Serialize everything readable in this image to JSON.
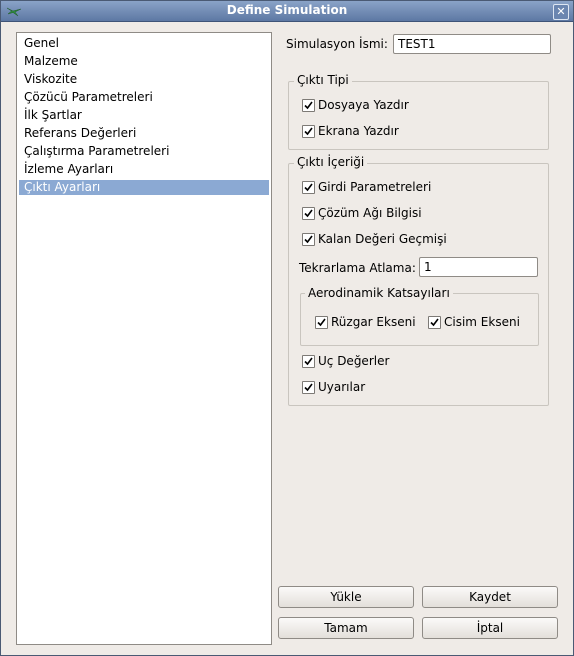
{
  "window": {
    "title": "Define Simulation"
  },
  "sidebar": {
    "items": [
      {
        "label": "Genel"
      },
      {
        "label": "Malzeme"
      },
      {
        "label": "Viskozite"
      },
      {
        "label": "Çözücü Parametreleri"
      },
      {
        "label": "İlk Şartlar"
      },
      {
        "label": "Referans Değerleri"
      },
      {
        "label": "Çalıştırma Parametreleri"
      },
      {
        "label": "İzleme Ayarları"
      },
      {
        "label": "Çıktı Ayarları",
        "selected": true
      }
    ]
  },
  "form": {
    "sim_name_label": "Simulasyon İsmi:",
    "sim_name_value": "TEST1",
    "output_type": {
      "title": "Çıktı Tipi",
      "write_file": {
        "label": "Dosyaya Yazdır",
        "checked": true
      },
      "write_screen": {
        "label": "Ekrana Yazdır",
        "checked": true
      }
    },
    "output_content": {
      "title": "Çıktı İçeriği",
      "input_params": {
        "label": "Girdi Parametreleri",
        "checked": true
      },
      "mesh_info": {
        "label": "Çözüm Ağı Bilgisi",
        "checked": true
      },
      "residual_history": {
        "label": "Kalan Değeri Geçmişi",
        "checked": true
      },
      "iter_skip_label": "Tekrarlama Atlama:",
      "iter_skip_value": "1",
      "aero": {
        "title": "Aerodinamik Katsayıları",
        "wind_axis": {
          "label": "Rüzgar Ekseni",
          "checked": true
        },
        "body_axis": {
          "label": "Cisim Ekseni",
          "checked": true
        }
      },
      "extreme_values": {
        "label": "Uç Değerler",
        "checked": true
      },
      "warnings": {
        "label": "Uyarılar",
        "checked": true
      }
    }
  },
  "buttons": {
    "load": "Yükle",
    "save": "Kaydet",
    "ok": "Tamam",
    "cancel": "İptal"
  }
}
